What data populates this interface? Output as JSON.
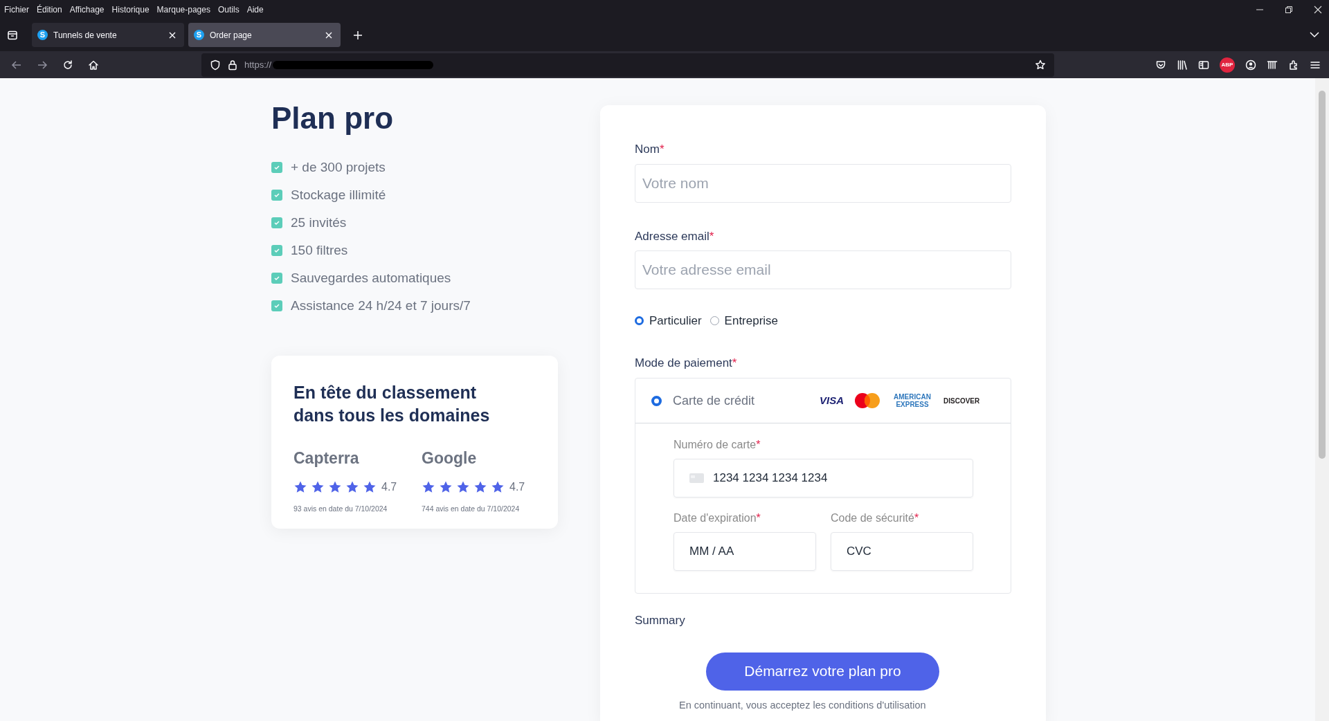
{
  "menu_bar": [
    "Fichier",
    "Édition",
    "Affichage",
    "Historique",
    "Marque-pages",
    "Outils",
    "Aide"
  ],
  "tabs": [
    {
      "label": "Tunnels de vente",
      "favicon": "S",
      "selected": false
    },
    {
      "label": "Order page",
      "favicon": "S",
      "selected": true
    }
  ],
  "address_bar": {
    "url": "https://"
  },
  "toolbar": {
    "adblock_badge": "ABP"
  },
  "plan": {
    "title": "Plan pro",
    "features": [
      {
        "label": "+ de 300 projets",
        "checked": true
      },
      {
        "label": "Stockage illimité",
        "checked": true
      },
      {
        "label": "25 invités",
        "checked": true
      },
      {
        "label": "150 filtres",
        "checked": true
      },
      {
        "label": "Sauvegardes automatiques",
        "checked": true
      },
      {
        "label": "Assistance 24 h/24 et 7 jours/7",
        "checked": true
      }
    ]
  },
  "rankings": {
    "title": "En tête du classement dans tous les domaines",
    "sources": [
      {
        "name": "Capterra",
        "stars": 5,
        "rating": "4.7",
        "note": "93 avis en date du 7/10/2024"
      },
      {
        "name": "Google",
        "stars": 5,
        "rating": "4.7",
        "note": "744 avis en date du 7/10/2024"
      }
    ]
  },
  "form": {
    "name_field": {
      "label": "Nom",
      "required_mark": "*",
      "placeholder": "Votre nom"
    },
    "email_field": {
      "label": "Adresse email",
      "required_mark": "*",
      "placeholder": "Votre adresse email"
    },
    "customer_type": [
      {
        "label": "Particulier",
        "selected": true
      },
      {
        "label": "Entreprise",
        "selected": false
      }
    ],
    "payment": {
      "label": "Mode de paiement",
      "required_mark": "*",
      "methods": [
        {
          "label": "Carte de crédit",
          "selected": true
        }
      ],
      "card_brands": [
        {
          "kind": "visa",
          "label": "VISA"
        },
        {
          "kind": "mastercard"
        },
        {
          "kind": "amex",
          "label": "AMERICAN EXPRESS"
        },
        {
          "kind": "discover",
          "label": "DISCOVER"
        }
      ],
      "card_number": {
        "label": "Numéro de carte",
        "required_mark": "*",
        "placeholder": "1234 1234 1234 1234"
      },
      "expiry": {
        "label": "Date d'expiration",
        "required_mark": "*",
        "placeholder": "MM / AA"
      },
      "cvc": {
        "label": "Code de sécurité",
        "required_mark": "*",
        "placeholder": "CVC"
      }
    },
    "summary_label": "Summary",
    "submit_button": "Démarrez votre plan pro",
    "terms": "En continuant, vous acceptez les conditions d'utilisation"
  }
}
